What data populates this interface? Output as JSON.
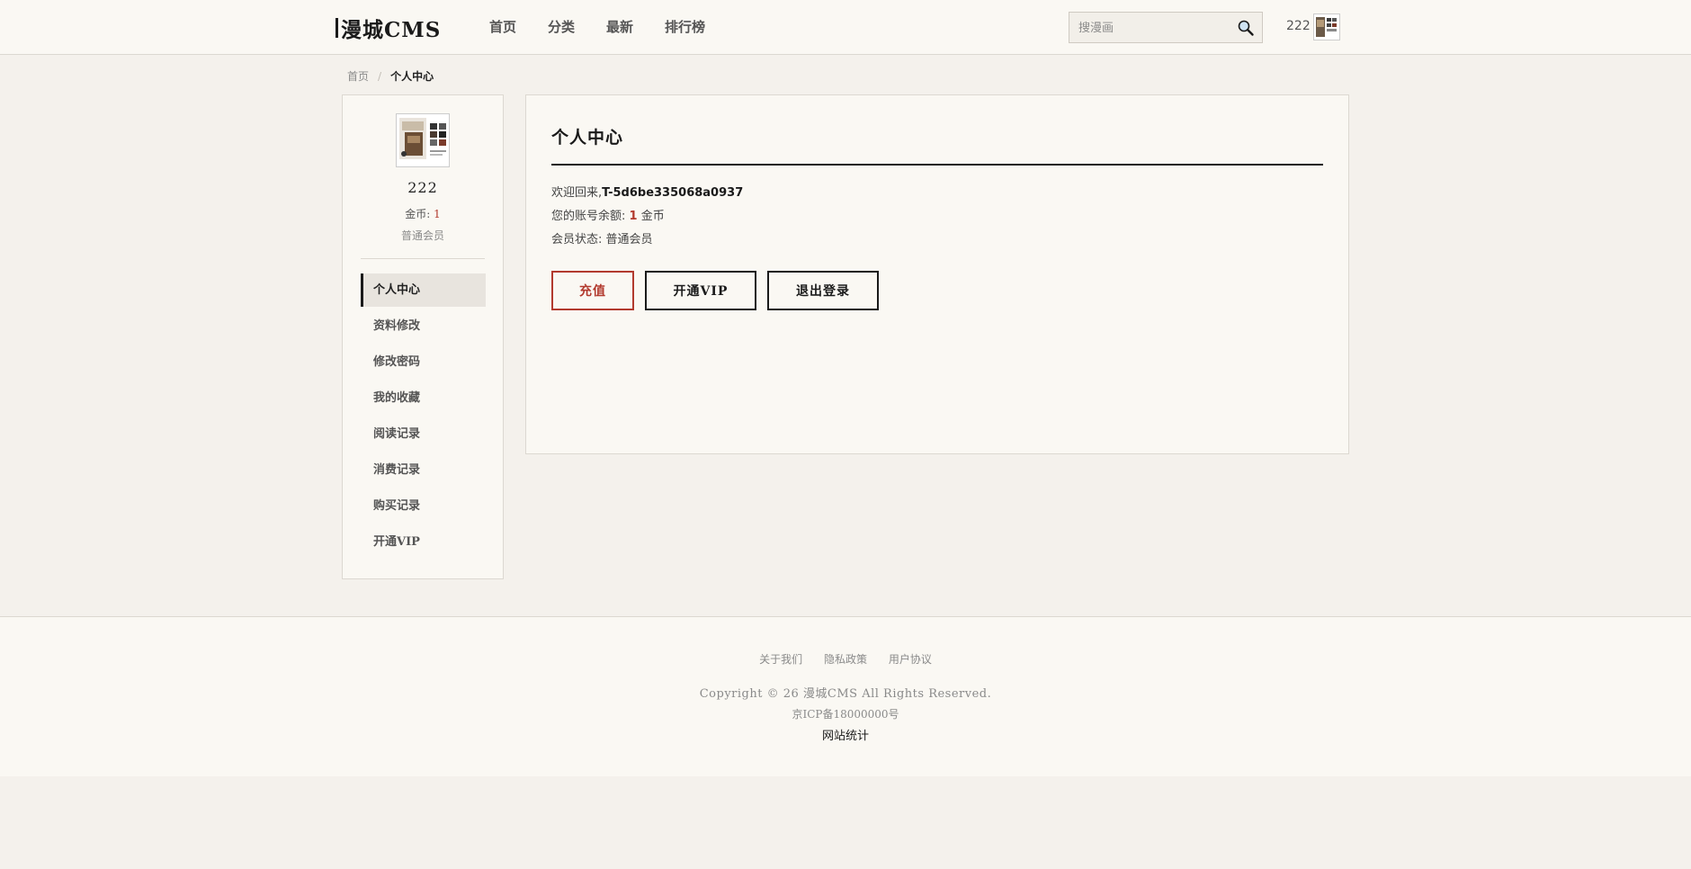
{
  "header": {
    "logo": "漫城CMS",
    "nav": [
      "首页",
      "分类",
      "最新",
      "排行榜"
    ],
    "search_placeholder": "搜漫画",
    "user_name": "222"
  },
  "breadcrumb": {
    "home": "首页",
    "current": "个人中心"
  },
  "sidebar": {
    "name": "222",
    "coins_label": "金币:",
    "coins_value": "1",
    "level": "普通会员",
    "menu": [
      "个人中心",
      "资料修改",
      "修改密码",
      "我的收藏",
      "阅读记录",
      "消费记录",
      "购买记录",
      "开通VIP"
    ],
    "active_index": 0
  },
  "main": {
    "title": "个人中心",
    "welcome_label": "欢迎回来,",
    "welcome_user": "T-5d6be335068a0937",
    "balance_label": "您的账号余额:",
    "balance_value": "1",
    "balance_unit": "金币",
    "status_label": "会员状态:",
    "status_value": "普通会员",
    "buttons": {
      "recharge": "充值",
      "vip": "开通VIP",
      "logout": "退出登录"
    }
  },
  "footer": {
    "links": [
      "关于我们",
      "隐私政策",
      "用户协议"
    ],
    "copyright": "Copyright © 26 漫城CMS All Rights Reserved.",
    "icp": "京ICP备18000000号",
    "stats": "网站统计"
  }
}
